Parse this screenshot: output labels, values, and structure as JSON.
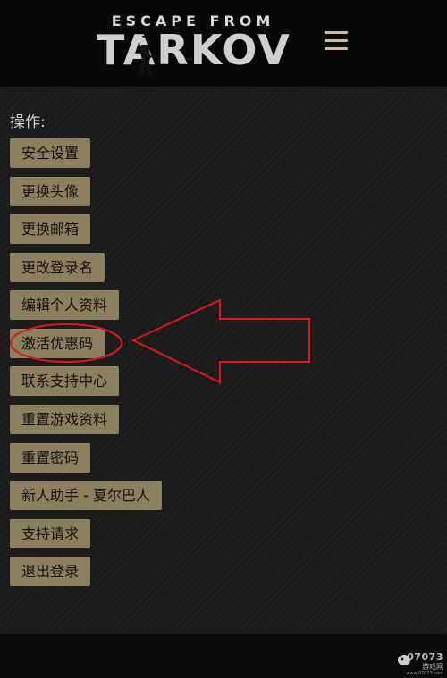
{
  "header": {
    "logo_top": "ESCAPE FROM",
    "logo_main": "TARKOV",
    "menu_icon": "hamburger-menu-icon"
  },
  "section": {
    "label": "操作:"
  },
  "menu": {
    "items": [
      {
        "label": "安全设置"
      },
      {
        "label": "更换头像"
      },
      {
        "label": "更换邮箱"
      },
      {
        "label": "更改登录名"
      },
      {
        "label": "编辑个人资料"
      },
      {
        "label": "激活优惠码"
      },
      {
        "label": "联系支持中心"
      },
      {
        "label": "重置游戏资料"
      },
      {
        "label": "重置密码"
      },
      {
        "label": "新人助手 - 夏尔巴人"
      },
      {
        "label": "支持请求"
      },
      {
        "label": "退出登录"
      }
    ]
  },
  "annotation": {
    "highlighted_item": "激活优惠码",
    "color": "#e0161b"
  },
  "watermark": {
    "number": "07073",
    "text": "游戏网",
    "url": "www.07073.com"
  },
  "colors": {
    "button_bg": "#8c7f5e",
    "button_text": "#111111",
    "background": "#1b1b1b",
    "header_bg": "#080808",
    "accent": "#c9bc95"
  }
}
